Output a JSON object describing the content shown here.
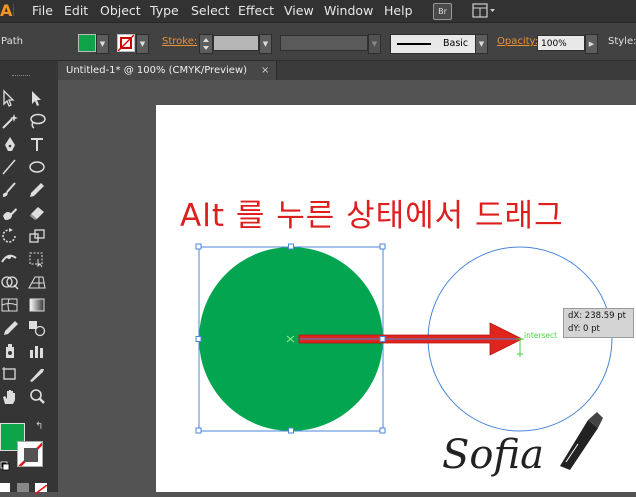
{
  "app": {
    "logo_text": "Ai",
    "menu": [
      "File",
      "Edit",
      "Object",
      "Type",
      "Select",
      "Effect",
      "View",
      "Window",
      "Help"
    ],
    "bridge_label": "Br"
  },
  "control_bar": {
    "selection_label": "Path",
    "fill_color": "#0ea54a",
    "stroke_label": "Stroke:",
    "brush_label": "Basic",
    "opacity_label": "Opacity:",
    "opacity_value": "100%",
    "style_label": "Style:"
  },
  "document": {
    "tab_title": "Untitled-1* @ 100% (CMYK/Preview)",
    "close_glyph": "×"
  },
  "artwork": {
    "headline": "Alt 를 누른 상태에서 드래그",
    "headline_color": "#dd1f1f",
    "circle_fill": "#03a550",
    "arrow_color": "#e0251f",
    "guide_color": "#4a86d8",
    "smart_guide_label": "intersect",
    "smart_guide_color": "#41d741",
    "signature": "Sofia"
  },
  "tooltip": {
    "dx": "dX: 238.59 pt",
    "dy": "dY: 0 pt"
  },
  "toolbox": {
    "fill_swatch": "#0ea54a"
  }
}
